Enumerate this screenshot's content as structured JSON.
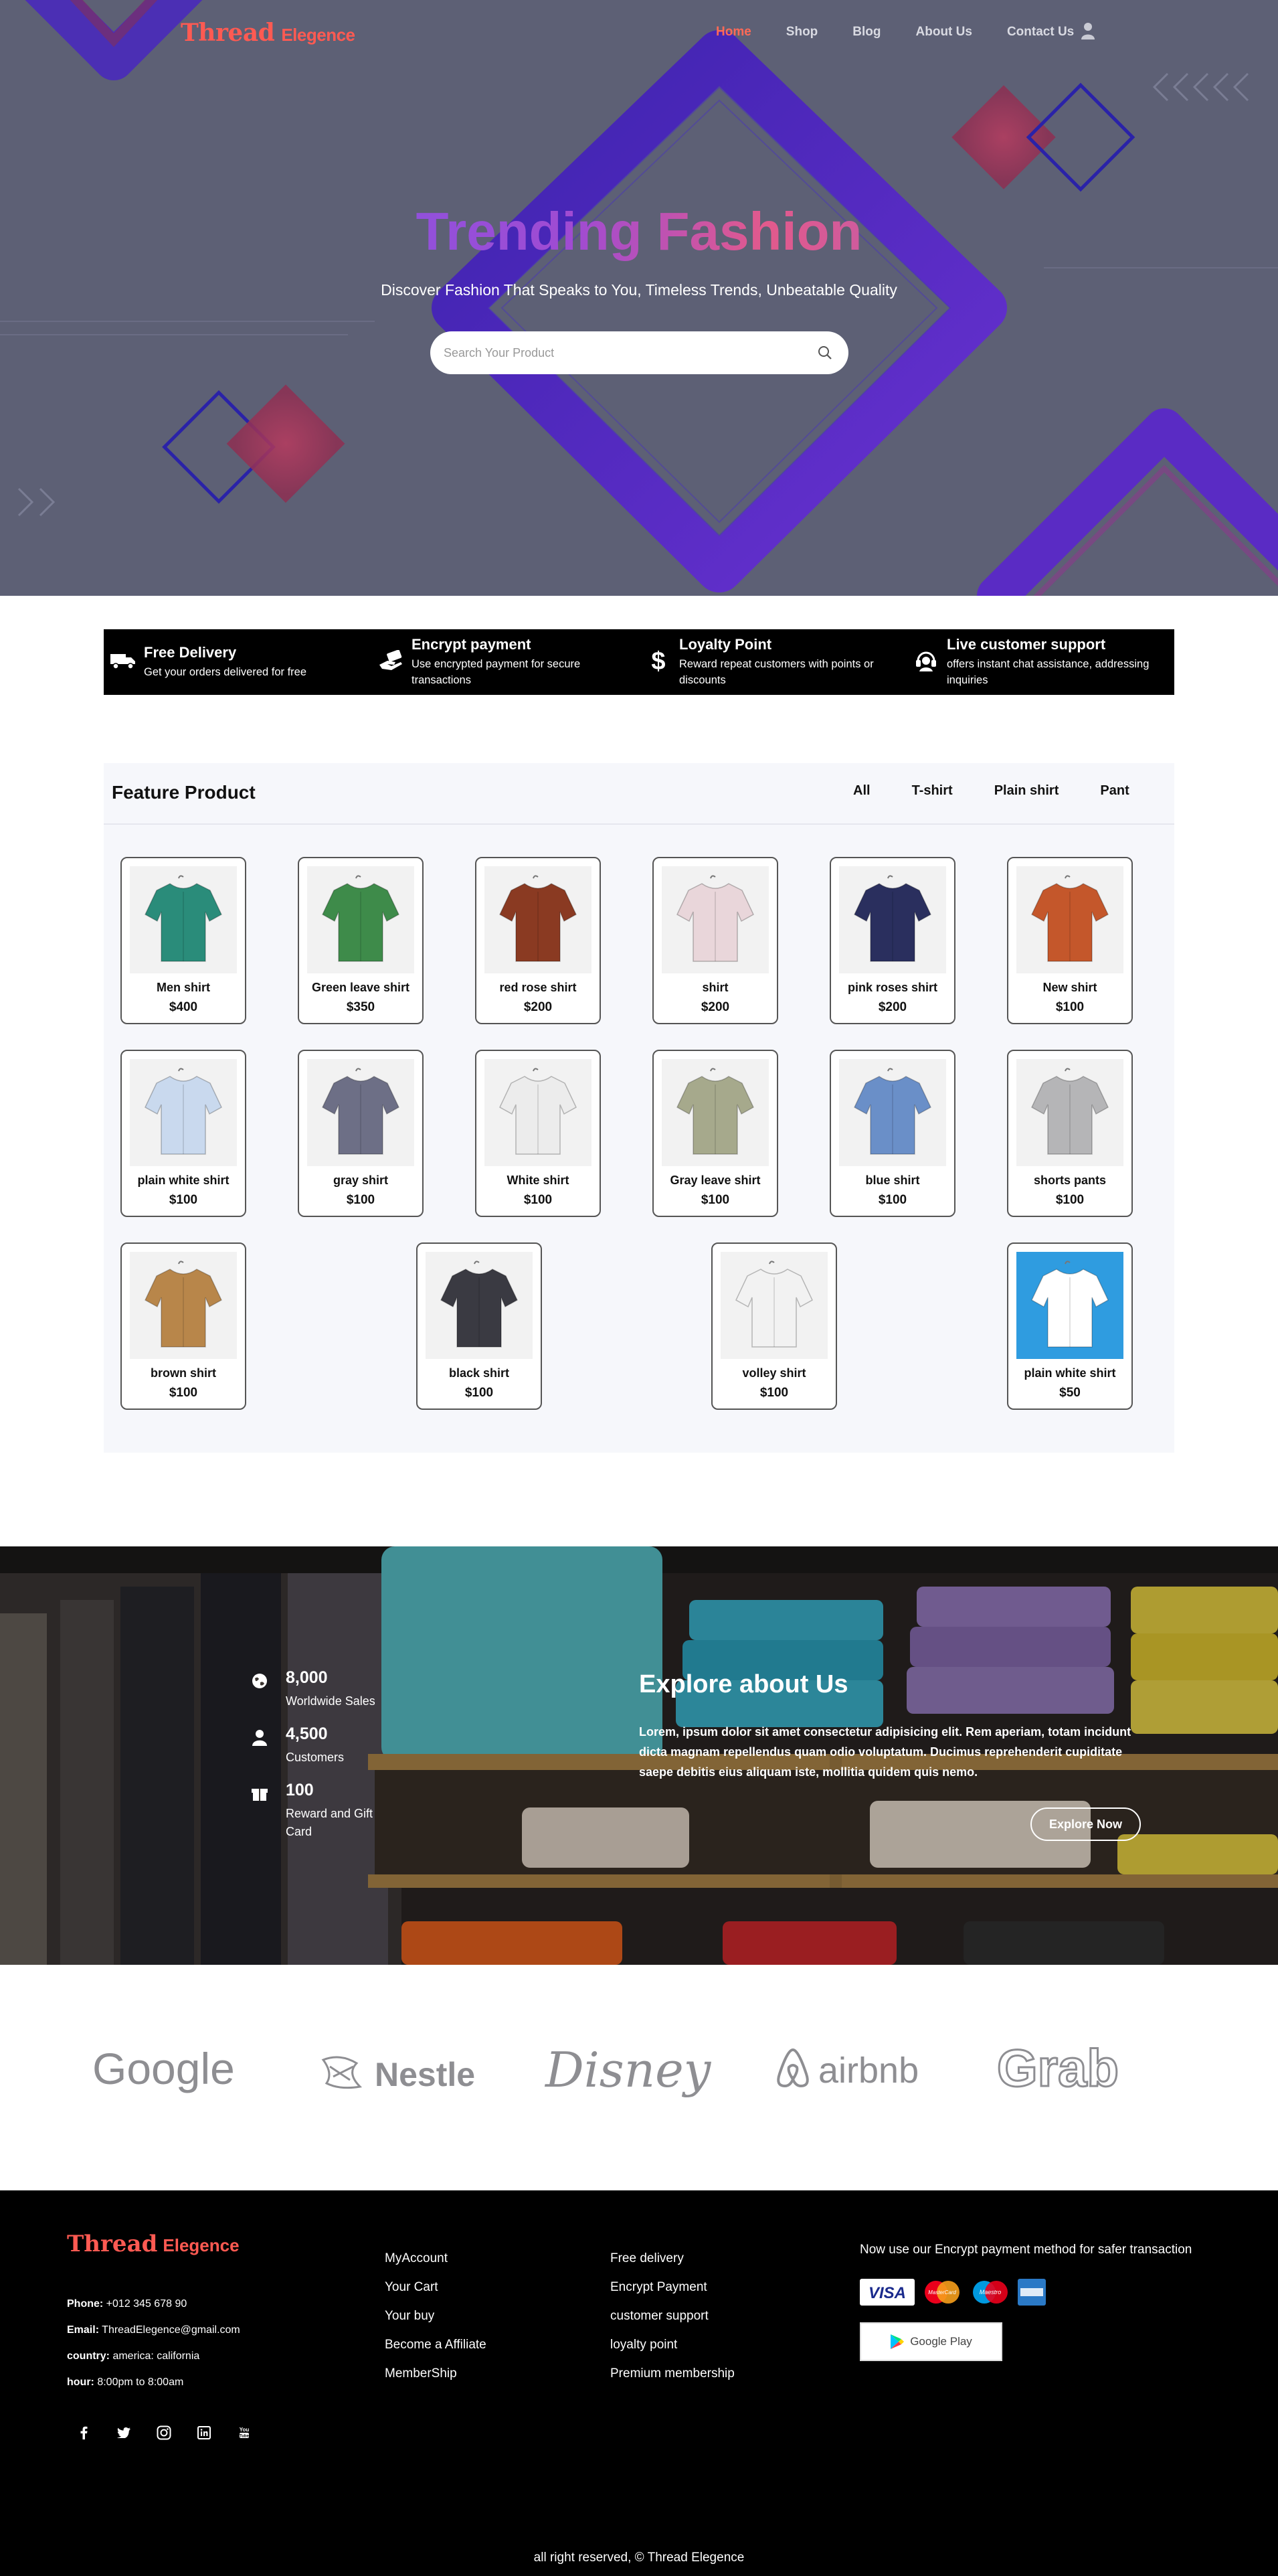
{
  "nav": {
    "logo_main": "Thread",
    "logo_sub": "Elegence",
    "items": [
      "Home",
      "Shop",
      "Blog",
      "About Us",
      "Contact Us"
    ]
  },
  "hero": {
    "title": "Trending Fashion",
    "subtitle": "Discover Fashion That Speaks to You, Timeless Trends, Unbeatable Quality",
    "search_placeholder": "Search Your Product"
  },
  "features": [
    {
      "title": "Free Delivery",
      "text": "Get your orders delivered for free",
      "icon": "truck-icon"
    },
    {
      "title": "Encrypt payment",
      "text": "Use encrypted payment for secure transactions",
      "icon": "hand-card-icon"
    },
    {
      "title": "Loyalty Point",
      "text": "Reward repeat customers with points or discounts",
      "icon": "dollar-icon"
    },
    {
      "title": "Live customer support",
      "text": "offers instant chat assistance, addressing inquiries",
      "icon": "headset-icon"
    }
  ],
  "products": {
    "title": "Feature Product",
    "filters": [
      "All",
      "T-shirt",
      "Plain shirt",
      "Pant"
    ],
    "items": [
      {
        "name": "Men shirt",
        "price": "$400",
        "color": "#2a8c7a"
      },
      {
        "name": "Green leave shirt",
        "price": "$350",
        "color": "#3e8b4a"
      },
      {
        "name": "red rose shirt",
        "price": "$200",
        "color": "#8a3a22"
      },
      {
        "name": "shirt",
        "price": "$200",
        "color": "#e9d6da"
      },
      {
        "name": "pink roses shirt",
        "price": "$200",
        "color": "#2a2f5e"
      },
      {
        "name": "New shirt",
        "price": "$100",
        "color": "#c4572b"
      },
      {
        "name": "plain white shirt",
        "price": "$100",
        "color": "#c9d9ee"
      },
      {
        "name": "gray shirt",
        "price": "$100",
        "color": "#6d6f86"
      },
      {
        "name": "White shirt",
        "price": "$100",
        "color": "#ececec"
      },
      {
        "name": "Gray leave shirt",
        "price": "$100",
        "color": "#a6a98c"
      },
      {
        "name": "blue shirt",
        "price": "$100",
        "color": "#6a8fc8"
      },
      {
        "name": "shorts pants",
        "price": "$100",
        "color": "#b5b5b7"
      },
      {
        "name": "brown shirt",
        "price": "$100",
        "color": "#b8864a"
      },
      {
        "name": "black shirt",
        "price": "$100",
        "color": "#3a3a42"
      },
      {
        "name": "volley shirt",
        "price": "$100",
        "color": "#f2f2f2"
      },
      {
        "name": "plain white shirt",
        "price": "$50",
        "color": "#ffffff"
      }
    ]
  },
  "explore": {
    "stats": [
      {
        "num": "8,000",
        "label": "Worldwide Sales",
        "icon": "globe-icon"
      },
      {
        "num": "4,500",
        "label": "Customers",
        "icon": "user-icon"
      },
      {
        "num": "100",
        "label": "Reward and Gift Card",
        "icon": "gift-icon"
      }
    ],
    "title": "Explore about Us",
    "text": "Lorem, ipsum dolor sit amet consectetur adipisicing elit. Rem aperiam, totam incidunt dicta magnam repellendus quam odio voluptatum. Ducimus reprehenderit cupiditate saepe debitis eius aliquam iste, mollitia quidem quis nemo.",
    "button": "Explore Now"
  },
  "brands": [
    "Google",
    "Nestle",
    "Disney",
    "airbnb",
    "Grab"
  ],
  "footer": {
    "logo_main": "Thread",
    "logo_sub": "Elegence",
    "phone_label": "Phone:",
    "phone": "+012 345 678 90",
    "email_label": "Email:",
    "email": "ThreadElegence@gmail.com",
    "country_label": "country:",
    "country": "america: california",
    "hour_label": "hour:",
    "hour": "8:00pm to 8:00am",
    "col1": [
      "MyAccount",
      "Your Cart",
      "Your buy",
      "Become a Affiliate",
      "MemberShip"
    ],
    "col2": [
      "Free delivery",
      "Encrypt Payment",
      "customer support",
      "loyalty point",
      "Premium membership"
    ],
    "pay_title": "Now use our Encrypt payment method for safer transaction",
    "gplay": "Google Play",
    "copyright": "all right reserved, © Thread Elegence"
  }
}
